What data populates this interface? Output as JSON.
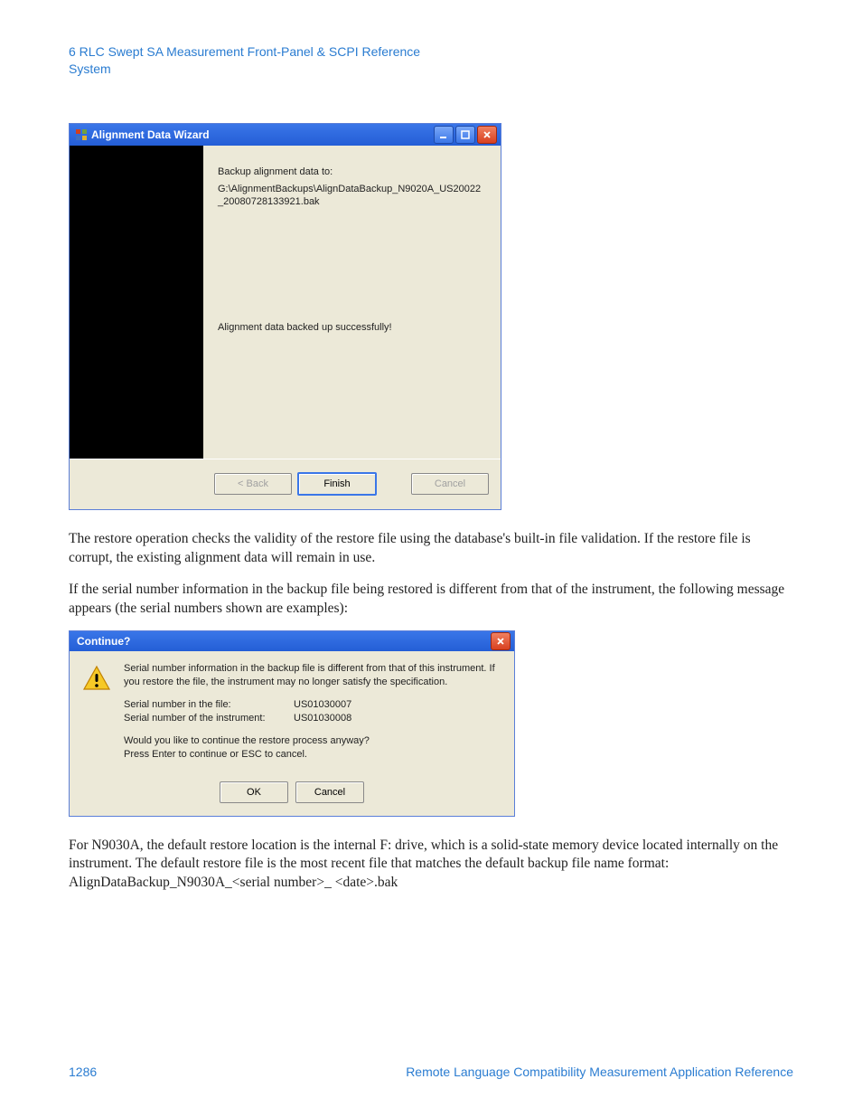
{
  "header": {
    "chapter_line": "6  RLC Swept SA Measurement Front-Panel & SCPI Reference",
    "section_line": "System"
  },
  "wizard": {
    "title": "Alignment Data Wizard",
    "backup_label": "Backup alignment data to:",
    "backup_path": "G:\\AlignmentBackups\\AlignDataBackup_N9020A_US20022_20080728133921.bak",
    "success_msg": "Alignment data backed up successfully!",
    "buttons": {
      "back": "< Back",
      "finish": "Finish",
      "cancel": "Cancel"
    }
  },
  "para1": "The restore operation checks the validity of the restore file using the database's built-in file validation.  If the restore file is corrupt, the existing alignment data will remain in use.",
  "para2": "If the serial number information in the backup file being restored is different from that of the instrument, the following message appears (the serial numbers shown are examples):",
  "msgbox": {
    "title": "Continue?",
    "line1": "Serial number information in the backup file is different from that of this instrument. If you restore the file, the instrument may no longer satisfy the specification.",
    "sn_file_label": "Serial number in the file:",
    "sn_file_value": "US01030007",
    "sn_inst_label": "Serial number of the instrument:",
    "sn_inst_value": "US01030008",
    "line3a": "Would you like to continue the restore process anyway?",
    "line3b": "Press Enter to continue or ESC to cancel.",
    "ok": "OK",
    "cancel": "Cancel"
  },
  "para3": "For N9030A, the default restore location is the internal F: drive, which is a solid-state memory device located internally on the instrument.  The default restore file is the most recent file that matches the default backup file name format: AlignDataBackup_N9030A_<serial number>_ <date>.bak",
  "footer": {
    "page_number": "1286",
    "doc_title": "Remote Language Compatibility Measurement Application Reference"
  }
}
